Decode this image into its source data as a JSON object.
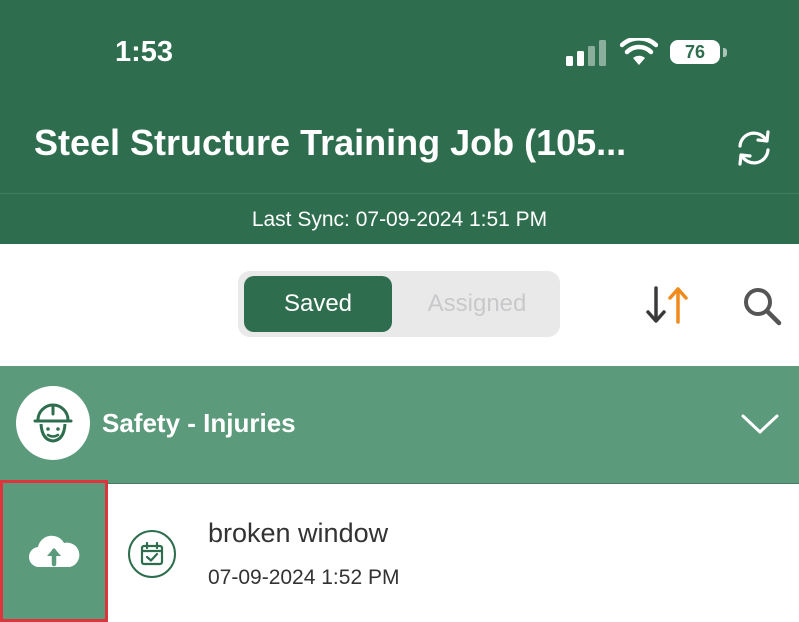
{
  "status_bar": {
    "time": "1:53",
    "battery": "76",
    "icons": [
      "signal-icon",
      "wifi-icon",
      "battery-icon"
    ]
  },
  "header": {
    "title": "Steel Structure Training Job (105...",
    "refresh_icon": "refresh-icon"
  },
  "sync": {
    "text": "Last Sync: 07-09-2024 1:51 PM"
  },
  "toolbar": {
    "segments": [
      "Saved",
      "Assigned"
    ],
    "selected": "Saved",
    "sort_icon": "sort-icon",
    "search_icon": "search-icon"
  },
  "section": {
    "title": "Safety - Injuries",
    "icon": "hardhat-worker-icon",
    "chevron": "chevron-down-icon"
  },
  "items": [
    {
      "title": "broken window",
      "date": "07-09-2024 1:52 PM",
      "upload_icon": "cloud-upload-icon",
      "type_icon": "calendar-check-icon"
    }
  ],
  "colors": {
    "primary_green": "#2e6e4e",
    "section_green": "#5b9a7b",
    "sort_accent": "#f08a1c",
    "highlight_border": "#e0343c"
  }
}
